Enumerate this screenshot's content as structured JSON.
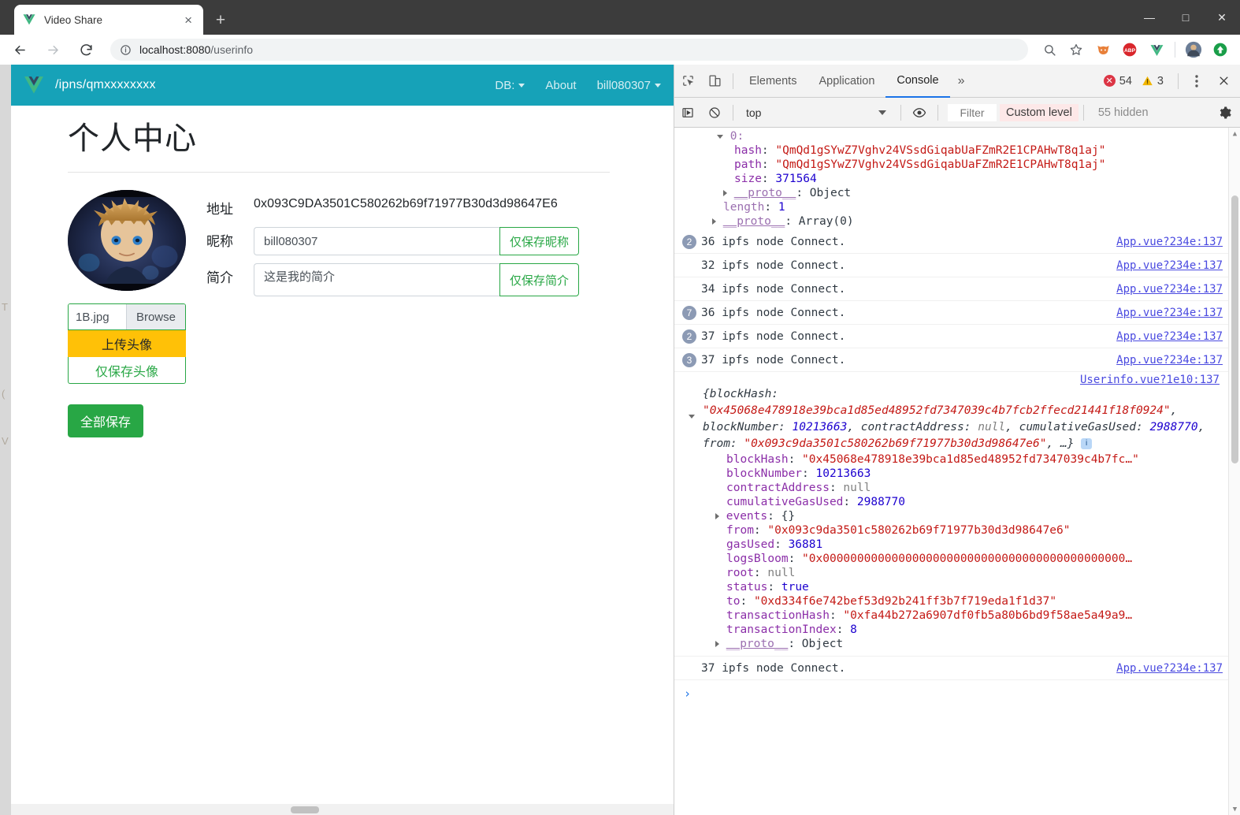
{
  "browser": {
    "tab": {
      "title": "Video Share",
      "favicon": "vue-logo-icon",
      "close": "×"
    },
    "new_tab_label": "+",
    "window_controls": {
      "minimize": "—",
      "maximize": "□",
      "close": "✕"
    },
    "omnibox": {
      "url_host": "localhost:8080",
      "url_path": "/userinfo",
      "info_icon": "info-icon"
    },
    "toolbar_icons": [
      "back-icon",
      "forward-icon",
      "reload-icon",
      "zoom-search-icon",
      "bookmark-star-icon",
      "extension-fox-icon",
      "adblock-plus-icon",
      "vue-devtools-icon",
      "profile-avatar",
      "update-arrow-icon"
    ],
    "adblock_label": "ABP"
  },
  "page": {
    "navbar": {
      "brand": "/ipns/qmxxxxxxxx",
      "links": [
        {
          "label": "DB:",
          "has_caret": true
        },
        {
          "label": "About",
          "has_caret": false
        },
        {
          "label": "bill080307",
          "has_caret": true
        }
      ],
      "bg_color": "#16a2b8"
    },
    "title": "个人中心",
    "form": {
      "address_label": "地址",
      "address_value": "0x093C9DA3501C580262b69f71977B30d3d98647E6",
      "nickname_label": "昵称",
      "nickname_value": "bill080307",
      "nickname_button": "仅保存昵称",
      "bio_label": "简介",
      "bio_value": "这是我的简介",
      "bio_button": "仅保存简介"
    },
    "upload": {
      "file_name": "1B.jpg",
      "browse_label": "Browse",
      "upload_label": "上传头像",
      "save_avatar_label": "仅保存头像",
      "save_all_label": "全部保存",
      "upload_color": "#ffc107",
      "save_all_color": "#28a745"
    }
  },
  "devtools": {
    "tabs": [
      {
        "label": "Elements",
        "active": false
      },
      {
        "label": "Application",
        "active": false
      },
      {
        "label": "Console",
        "active": true
      }
    ],
    "more_label": "»",
    "error_count": "54",
    "warning_count": "3",
    "menu_icon": "kebab-menu-icon",
    "close_icon": "close-icon",
    "filterbar": {
      "context": "top",
      "eye_icon": "eye-icon",
      "filter_placeholder": "Filter",
      "custom_level": "Custom level",
      "hidden_count": "55 hidden",
      "gear_icon": "gear-icon",
      "custom_level_bg": "#fde8e8"
    },
    "object_block": {
      "index_label": "0:",
      "hash_key": "hash",
      "hash_value": "\"QmQd1gSYwZ7Vghv24VSsdGiqabUaFZmR2E1CPAHwT8q1aj\"",
      "path_key": "path",
      "path_value": "\"QmQd1gSYwZ7Vghv24VSsdGiqabUaFZmR2E1CPAHwT8q1aj\"",
      "size_key": "size",
      "size_value": "371564",
      "proto_key": "__proto__",
      "proto_value": "Object",
      "length_key": "length",
      "length_value": "1",
      "proto2_key": "__proto__",
      "proto2_value": "Array(0)"
    },
    "log_rows": [
      {
        "count": "2",
        "message": "36 ipfs node Connect.",
        "source": "App.vue?234e:137"
      },
      {
        "count": "",
        "message": "32 ipfs node Connect.",
        "source": "App.vue?234e:137"
      },
      {
        "count": "",
        "message": "34 ipfs node Connect.",
        "source": "App.vue?234e:137"
      },
      {
        "count": "7",
        "message": "36 ipfs node Connect.",
        "source": "App.vue?234e:137"
      },
      {
        "count": "2",
        "message": "37 ipfs node Connect.",
        "source": "App.vue?234e:137"
      },
      {
        "count": "3",
        "message": "37 ipfs node Connect.",
        "source": "App.vue?234e:137"
      }
    ],
    "receipt": {
      "source": "Userinfo.vue?1e10:137",
      "preview": {
        "open_brace": "{",
        "p1_key": "blockHash: ",
        "p1_val": "\"0x45068e478918e39bca1d85ed48952fd7347039c4b7fcb2ffecd21441f18f0924\"",
        "p2_key": ", blockNumber: ",
        "p2_val": "10213663",
        "p3_key": ", contractAddress: ",
        "p3_val": "null",
        "p4_key": ", cumulativeGasUsed: ",
        "p4_val": "2988770",
        "p5_key": ", from: ",
        "p5_val": "\"0x093c9da3501c580262b69f71977b30d3d98647e6\"",
        "tail": ", …}",
        "info_badge": "i"
      },
      "properties": [
        {
          "key": "blockHash",
          "value": "\"0x45068e478918e39bca1d85ed48952fd7347039c4b7fc…\"",
          "type": "string"
        },
        {
          "key": "blockNumber",
          "value": "10213663",
          "type": "number"
        },
        {
          "key": "contractAddress",
          "value": "null",
          "type": "null"
        },
        {
          "key": "cumulativeGasUsed",
          "value": "2988770",
          "type": "number"
        },
        {
          "key": "events",
          "value": "{}",
          "type": "plain",
          "expandable": true
        },
        {
          "key": "from",
          "value": "\"0x093c9da3501c580262b69f71977b30d3d98647e6\"",
          "type": "string"
        },
        {
          "key": "gasUsed",
          "value": "36881",
          "type": "number"
        },
        {
          "key": "logsBloom",
          "value": "\"0x00000000000000000000000000000000000000000000…",
          "type": "string"
        },
        {
          "key": "root",
          "value": "null",
          "type": "null"
        },
        {
          "key": "status",
          "value": "true",
          "type": "keyword"
        },
        {
          "key": "to",
          "value": "\"0xd334f6e742bef53d92b241ff3b7f719eda1f1d37\"",
          "type": "string"
        },
        {
          "key": "transactionHash",
          "value": "\"0xfa44b272a6907df0fb5a80b6bd9f58ae5a49a9…",
          "type": "string"
        },
        {
          "key": "transactionIndex",
          "value": "8",
          "type": "number"
        },
        {
          "key": "__proto__",
          "value": "Object",
          "type": "plain",
          "expandable": true,
          "dim": true
        }
      ]
    },
    "last_log": {
      "count": "",
      "message": "37 ipfs node Connect.",
      "source": "App.vue?234e:137"
    },
    "prompt": "›"
  }
}
